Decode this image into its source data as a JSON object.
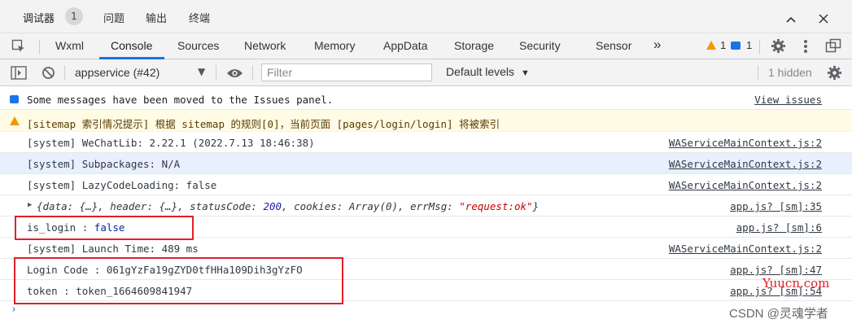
{
  "top_tabs": [
    {
      "label": "调试器",
      "active": true
    },
    {
      "label": "问题",
      "active": false
    },
    {
      "label": "输出",
      "active": false
    },
    {
      "label": "终端",
      "active": false
    }
  ],
  "issue_badge": "1",
  "panel_tabs": [
    {
      "label": "Wxml"
    },
    {
      "label": "Console"
    },
    {
      "label": "Sources"
    },
    {
      "label": "Network"
    },
    {
      "label": "Memory"
    },
    {
      "label": "AppData"
    },
    {
      "label": "Storage"
    },
    {
      "label": "Security"
    },
    {
      "label": "Sensor"
    }
  ],
  "active_panel": "Console",
  "more_tabs_glyph": "»",
  "warning_count": "1",
  "message_count": "1",
  "toolbar": {
    "context": "appservice (#42)",
    "filter_placeholder": "Filter",
    "levels": "Default levels",
    "hidden": "1 hidden"
  },
  "messages": {
    "moved_text": "Some messages have been moved to the Issues panel.",
    "moved_link": "View issues",
    "sitemap_warning": "[sitemap 索引情况提示] 根据 sitemap 的规则[0]，当前页面 [pages/login/login] 将被索引",
    "wechatlib": "[system] WeChatLib: 2.22.1 (2022.7.13 18:46:38)",
    "wechatlib_src": "WAServiceMainContext.js:2",
    "subpackages": "[system] Subpackages: N/A",
    "subpackages_src": "WAServiceMainContext.js:2",
    "lazy": "[system] LazyCodeLoading: false",
    "lazy_src": "WAServiceMainContext.js:2",
    "obj_prefix": "{data: {…}, header: {…}, statusCode: ",
    "obj_status": "200",
    "obj_mid": ", cookies: Array(0), errMsg: ",
    "obj_errmsg": "\"request:ok\"",
    "obj_suffix": "}",
    "obj_src": "app.js? [sm]:35",
    "islogin_label": "is_login :  ",
    "islogin_value": "false",
    "islogin_src": "app.js? [sm]:6",
    "launch": "[system] Launch Time: 489 ms",
    "launch_src": "WAServiceMainContext.js:2",
    "logincode": "Login Code : 061gYzFa19gZYD0tfHHa109Dih3gYzFO",
    "logincode_src": "app.js? [sm]:47",
    "token": "token : token_1664609841947",
    "token_src": "app.js? [sm]:54"
  },
  "watermarks": {
    "site": "Yuucn.com",
    "csdn": "CSDN @灵魂学者"
  }
}
